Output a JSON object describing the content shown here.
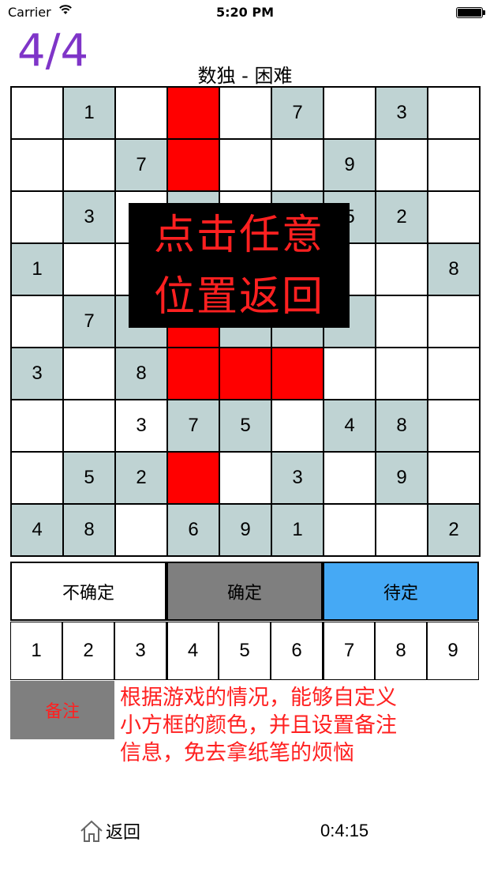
{
  "status_bar": {
    "carrier": "Carrier",
    "time": "5:20 PM",
    "battery_level": 1.0
  },
  "header": {
    "counter": "4/4",
    "title": "数独 - 困难"
  },
  "colors": {
    "gray": "#bfd3d3",
    "red": "#ff0000",
    "white": "#ffffff",
    "blue": "#45a9f5",
    "button_gray": "#7f7f7f",
    "counter_purple": "#7f35c8",
    "note_red": "#ff2020"
  },
  "board": {
    "rows": [
      [
        {
          "v": "",
          "c": "white"
        },
        {
          "v": "1",
          "c": "gray"
        },
        {
          "v": "",
          "c": "white"
        },
        {
          "v": "",
          "c": "red"
        },
        {
          "v": "",
          "c": "white"
        },
        {
          "v": "7",
          "c": "gray"
        },
        {
          "v": "",
          "c": "white"
        },
        {
          "v": "3",
          "c": "gray"
        },
        {
          "v": "",
          "c": "white"
        }
      ],
      [
        {
          "v": "",
          "c": "white"
        },
        {
          "v": "",
          "c": "white"
        },
        {
          "v": "7",
          "c": "gray"
        },
        {
          "v": "",
          "c": "red"
        },
        {
          "v": "",
          "c": "white"
        },
        {
          "v": "",
          "c": "white"
        },
        {
          "v": "9",
          "c": "gray"
        },
        {
          "v": "",
          "c": "white"
        },
        {
          "v": "",
          "c": "white"
        }
      ],
      [
        {
          "v": "",
          "c": "white"
        },
        {
          "v": "3",
          "c": "gray"
        },
        {
          "v": "",
          "c": "white"
        },
        {
          "v": "",
          "c": "gray"
        },
        {
          "v": "",
          "c": "white"
        },
        {
          "v": "",
          "c": "gray"
        },
        {
          "v": "5",
          "c": "gray"
        },
        {
          "v": "2",
          "c": "gray"
        },
        {
          "v": "",
          "c": "white"
        }
      ],
      [
        {
          "v": "1",
          "c": "gray"
        },
        {
          "v": "",
          "c": "white"
        },
        {
          "v": "",
          "c": "white"
        },
        {
          "v": "",
          "c": "white"
        },
        {
          "v": "",
          "c": "white"
        },
        {
          "v": "",
          "c": "white"
        },
        {
          "v": "",
          "c": "white"
        },
        {
          "v": "",
          "c": "white"
        },
        {
          "v": "8",
          "c": "gray"
        }
      ],
      [
        {
          "v": "",
          "c": "white"
        },
        {
          "v": "7",
          "c": "gray"
        },
        {
          "v": "",
          "c": "gray"
        },
        {
          "v": "",
          "c": "red"
        },
        {
          "v": "",
          "c": "gray"
        },
        {
          "v": "",
          "c": "gray"
        },
        {
          "v": "",
          "c": "gray"
        },
        {
          "v": "",
          "c": "white"
        },
        {
          "v": "",
          "c": "white"
        }
      ],
      [
        {
          "v": "3",
          "c": "gray"
        },
        {
          "v": "",
          "c": "white"
        },
        {
          "v": "8",
          "c": "gray"
        },
        {
          "v": "",
          "c": "red"
        },
        {
          "v": "",
          "c": "red"
        },
        {
          "v": "",
          "c": "red"
        },
        {
          "v": "",
          "c": "white"
        },
        {
          "v": "",
          "c": "white"
        },
        {
          "v": "",
          "c": "white"
        }
      ],
      [
        {
          "v": "",
          "c": "white"
        },
        {
          "v": "",
          "c": "white"
        },
        {
          "v": "3",
          "c": "white"
        },
        {
          "v": "7",
          "c": "gray"
        },
        {
          "v": "5",
          "c": "gray"
        },
        {
          "v": "",
          "c": "white"
        },
        {
          "v": "4",
          "c": "gray"
        },
        {
          "v": "8",
          "c": "gray"
        },
        {
          "v": "",
          "c": "white"
        }
      ],
      [
        {
          "v": "",
          "c": "white"
        },
        {
          "v": "5",
          "c": "gray"
        },
        {
          "v": "2",
          "c": "gray"
        },
        {
          "v": "",
          "c": "red"
        },
        {
          "v": "",
          "c": "white"
        },
        {
          "v": "3",
          "c": "gray"
        },
        {
          "v": "",
          "c": "white"
        },
        {
          "v": "9",
          "c": "gray"
        },
        {
          "v": "",
          "c": "white"
        }
      ],
      [
        {
          "v": "4",
          "c": "gray"
        },
        {
          "v": "8",
          "c": "gray"
        },
        {
          "v": "",
          "c": "white"
        },
        {
          "v": "6",
          "c": "gray"
        },
        {
          "v": "9",
          "c": "gray"
        },
        {
          "v": "1",
          "c": "gray"
        },
        {
          "v": "",
          "c": "white"
        },
        {
          "v": "",
          "c": "white"
        },
        {
          "v": "2",
          "c": "gray"
        }
      ]
    ]
  },
  "overlay": {
    "line1": "点击任意",
    "line2": "位置返回"
  },
  "status_buttons": [
    {
      "label": "不确定",
      "color": "white"
    },
    {
      "label": "确定",
      "color": "button_gray"
    },
    {
      "label": "待定",
      "color": "blue"
    }
  ],
  "numbers": [
    "1",
    "2",
    "3",
    "4",
    "5",
    "6",
    "7",
    "8",
    "9"
  ],
  "note": {
    "button_label": "备注",
    "lines": [
      "根据游戏的情况，能够自定义",
      "小方框的颜色，并且设置备注",
      "信息，免去拿纸笔的烦恼"
    ]
  },
  "footer": {
    "back_label": "返回",
    "back_icon": "home-icon",
    "timer": "0:4:15"
  }
}
